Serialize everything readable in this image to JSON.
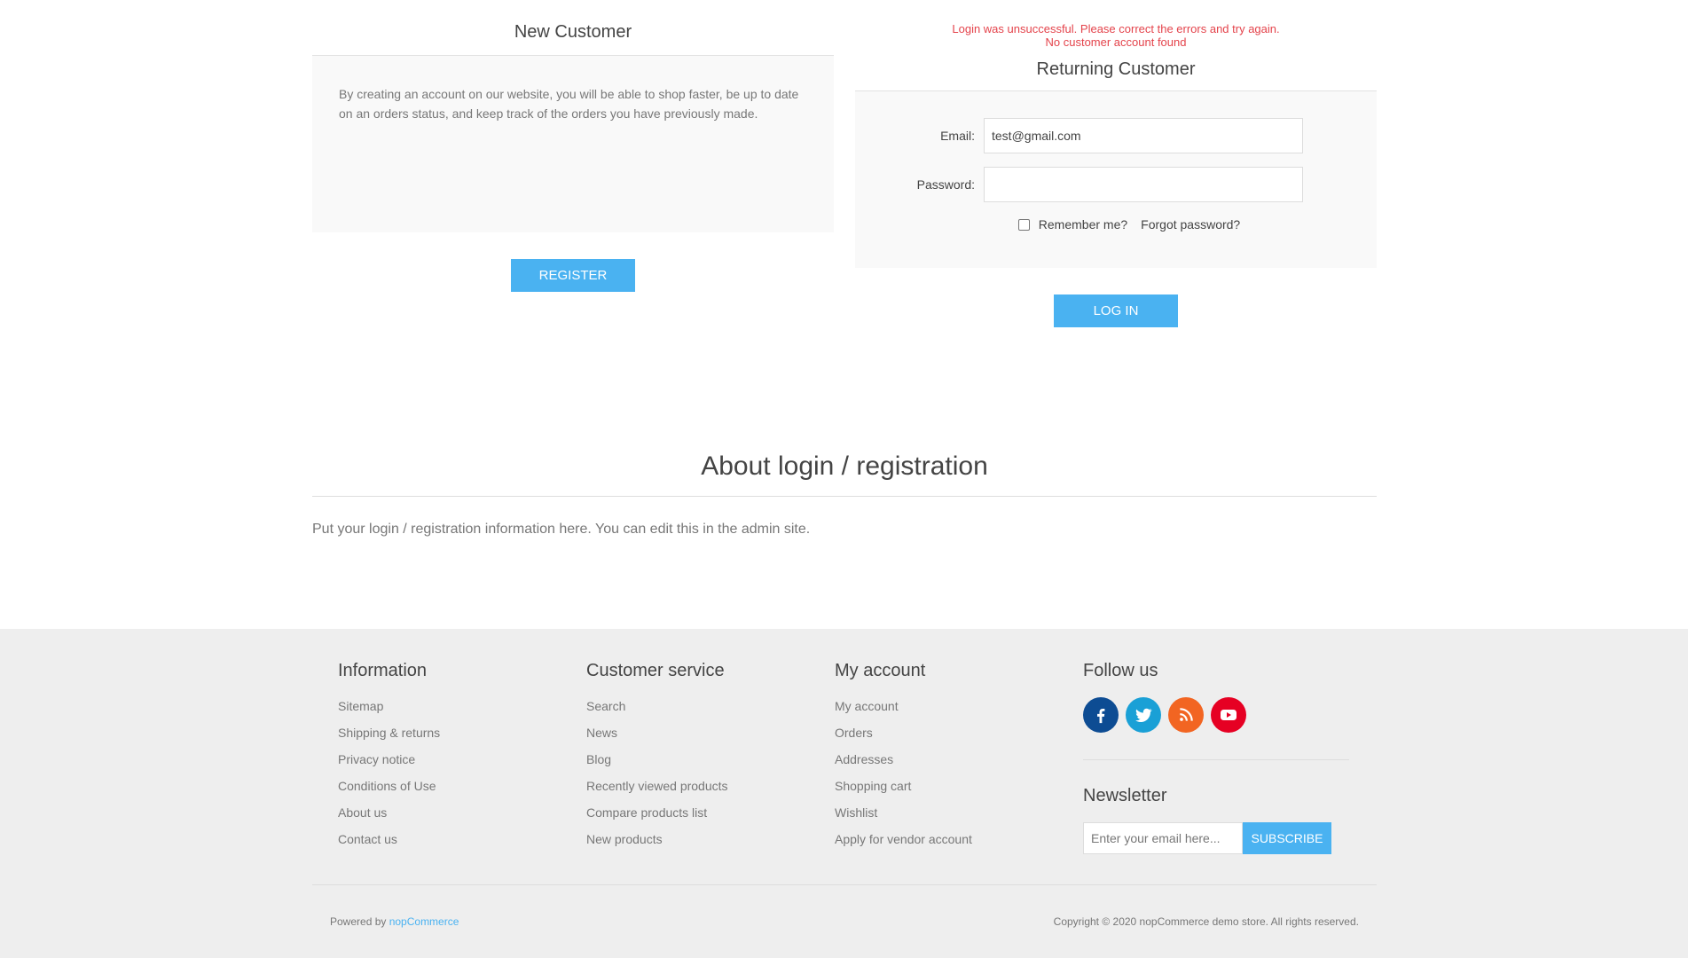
{
  "new_customer": {
    "title": "New Customer",
    "description": "By creating an account on our website, you will be able to shop faster, be up to date on an orders status, and keep track of the orders you have previously made.",
    "register_label": "Register"
  },
  "returning_customer": {
    "error_line1": "Login was unsuccessful. Please correct the errors and try again.",
    "error_line2": "No customer account found",
    "title": "Returning Customer",
    "email_label": "Email:",
    "email_value": "test@gmail.com",
    "password_label": "Password:",
    "password_value": "",
    "remember_label": "Remember me?",
    "remember_checked": false,
    "forgot_label": "Forgot password?",
    "login_label": "Log in"
  },
  "about": {
    "title": "About login / registration",
    "text": "Put your login / registration information here. You can edit this in the admin site."
  },
  "footer": {
    "information": {
      "title": "Information",
      "links": [
        "Sitemap",
        "Shipping & returns",
        "Privacy notice",
        "Conditions of Use",
        "About us",
        "Contact us"
      ]
    },
    "customer_service": {
      "title": "Customer service",
      "links": [
        "Search",
        "News",
        "Blog",
        "Recently viewed products",
        "Compare products list",
        "New products"
      ]
    },
    "my_account": {
      "title": "My account",
      "links": [
        "My account",
        "Orders",
        "Addresses",
        "Shopping cart",
        "Wishlist",
        "Apply for vendor account"
      ]
    },
    "follow_us": {
      "title": "Follow us",
      "icons": [
        {
          "name": "facebook-icon",
          "color": "#0d4c93"
        },
        {
          "name": "twitter-icon",
          "color": "#1aa0d6"
        },
        {
          "name": "rss-icon",
          "color": "#f26522"
        },
        {
          "name": "youtube-icon",
          "color": "#e60023"
        }
      ]
    },
    "newsletter": {
      "title": "Newsletter",
      "placeholder": "Enter your email here...",
      "button": "Subscribe"
    },
    "powered_by_prefix": "Powered by ",
    "powered_by_link": "nopCommerce",
    "copyright": "Copyright © 2020 nopCommerce demo store. All rights reserved."
  },
  "colors": {
    "accent": "#4ab2f1",
    "error": "#e4434b",
    "footer_bg": "#eeeeee",
    "panel_bg": "#f9f9f9"
  }
}
